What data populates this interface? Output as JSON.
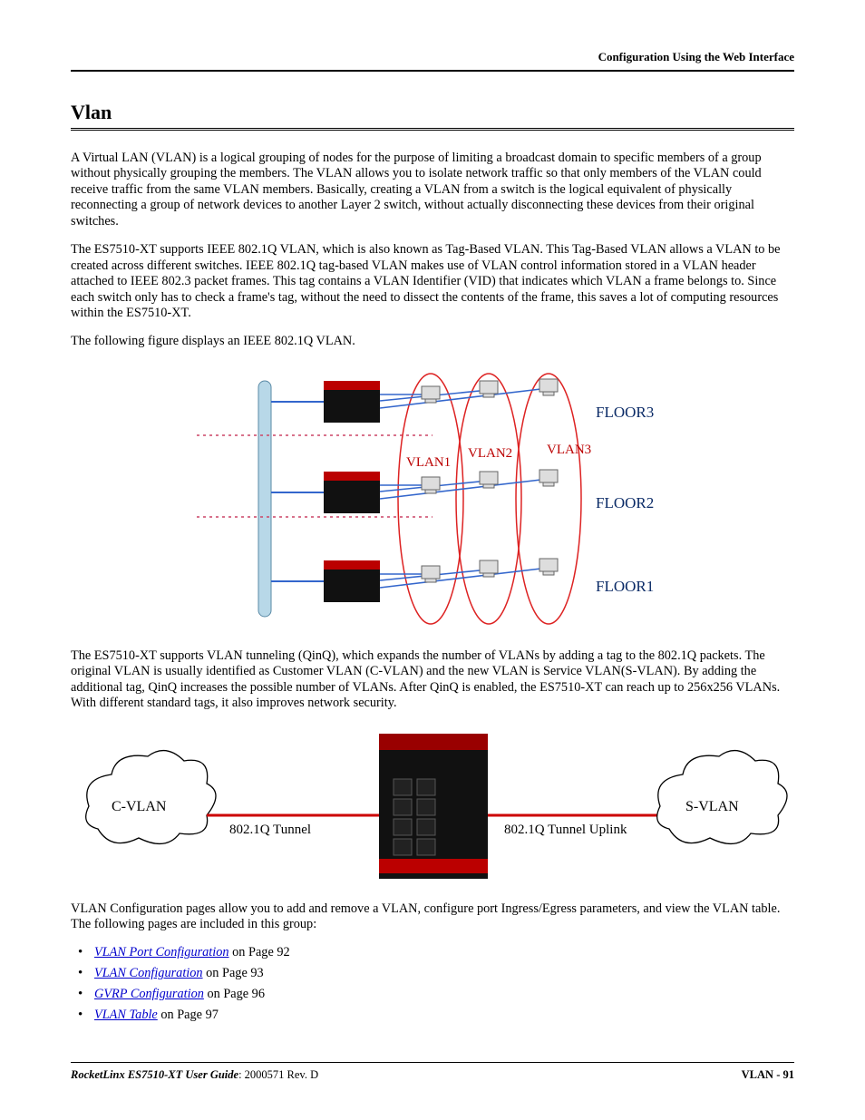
{
  "header": {
    "right": "Configuration Using the Web Interface"
  },
  "title": "Vlan",
  "paragraphs": {
    "p1": "A Virtual LAN (VLAN) is a logical grouping of nodes for the purpose of limiting a broadcast domain to specific members of a group without physically grouping the members. The VLAN allows you to isolate network traffic so that only members of the VLAN could receive traffic from the same VLAN members. Basically, creating a VLAN from a switch is the logical equivalent of physically reconnecting a group of network devices to another Layer 2 switch, without actually disconnecting these devices from their original switches.",
    "p2": "The ES7510-XT supports IEEE 802.1Q VLAN, which is also known as Tag-Based VLAN. This Tag-Based VLAN allows a VLAN to be created across different switches. IEEE 802.1Q tag-based VLAN makes use of VLAN control information stored in a VLAN header attached to IEEE 802.3 packet frames. This tag contains a VLAN Identifier (VID) that indicates which VLAN a frame belongs to. Since each switch only has to check a frame's tag, without the need to dissect the contents of the frame, this saves a lot of computing resources within the ES7510-XT.",
    "p3": "The following figure displays an IEEE 802.1Q VLAN.",
    "p4": "The ES7510-XT supports VLAN tunneling (QinQ), which expands the number of VLANs by adding a tag to the 802.1Q packets. The original VLAN is usually identified as Customer VLAN (C-VLAN) and the new VLAN is Service VLAN(S-VLAN). By adding the additional tag, QinQ increases the possible number of VLANs. After QinQ is enabled, the ES7510-XT can reach up to 256x256 VLANs. With different standard tags, it also improves network security.",
    "p5": "VLAN Configuration pages allow you to add and remove a VLAN, configure port Ingress/Egress parameters, and view the VLAN table. The following pages are included in this group:"
  },
  "figure1": {
    "labels": {
      "vlan1": "VLAN1",
      "vlan2": "VLAN2",
      "vlan3": "VLAN3",
      "floor1": "FLOOR1",
      "floor2": "FLOOR2",
      "floor3": "FLOOR3"
    }
  },
  "figure2": {
    "labels": {
      "cvlan": "C-VLAN",
      "svlan": "S-VLAN",
      "tunnel": "802.1Q Tunnel",
      "uplink": "802.1Q Tunnel Uplink"
    }
  },
  "links": [
    {
      "text": "VLAN Port Configuration",
      "suffix": " on Page 92"
    },
    {
      "text": "VLAN Configuration",
      "suffix": " on Page 93"
    },
    {
      "text": "GVRP Configuration",
      "suffix": " on Page 96"
    },
    {
      "text": "VLAN Table",
      "suffix": " on Page 97"
    }
  ],
  "footer": {
    "guide": "RocketLinx ES7510-XT  User Guide",
    "rev": ": 2000571 Rev. D",
    "right": "VLAN - 91"
  }
}
